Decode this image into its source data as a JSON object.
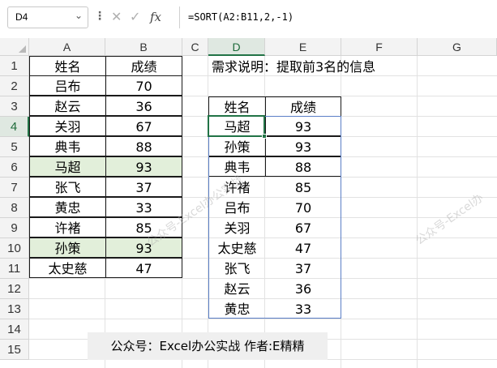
{
  "formula_bar": {
    "name_box": "D4",
    "cancel_icon": "✕",
    "enter_icon": "✓",
    "fx_label": "fx",
    "formula": "=SORT(A2:B11,2,-1)"
  },
  "columns": [
    "A",
    "B",
    "C",
    "D",
    "E",
    "F",
    "G"
  ],
  "rows": [
    "1",
    "2",
    "3",
    "4",
    "5",
    "6",
    "7",
    "8",
    "9",
    "10",
    "11",
    "12",
    "13",
    "14",
    "15"
  ],
  "source_table": {
    "headers": [
      "姓名",
      "成绩"
    ],
    "rows": [
      [
        "吕布",
        "70"
      ],
      [
        "赵云",
        "36"
      ],
      [
        "关羽",
        "67"
      ],
      [
        "典韦",
        "88"
      ],
      [
        "马超",
        "93"
      ],
      [
        "张飞",
        "37"
      ],
      [
        "黄忠",
        "33"
      ],
      [
        "许褚",
        "85"
      ],
      [
        "孙策",
        "93"
      ],
      [
        "太史慈",
        "47"
      ]
    ]
  },
  "note": "需求说明：提取前3名的信息",
  "result_table": {
    "headers": [
      "姓名",
      "成绩"
    ],
    "rows": [
      [
        "马超",
        "93"
      ],
      [
        "孙策",
        "93"
      ],
      [
        "典韦",
        "88"
      ],
      [
        "许褚",
        "85"
      ],
      [
        "吕布",
        "70"
      ],
      [
        "关羽",
        "67"
      ],
      [
        "太史慈",
        "47"
      ],
      [
        "张飞",
        "37"
      ],
      [
        "赵云",
        "36"
      ],
      [
        "黄忠",
        "33"
      ]
    ]
  },
  "footer": "公众号：Excel办公实战 作者:E精精",
  "watermark": [
    "公众号-Excel办公实战",
    "公众号-Excel办"
  ],
  "colors": {
    "highlight": "#e2efda",
    "selection": "#217346",
    "spill_border": "#5b7fc7"
  }
}
